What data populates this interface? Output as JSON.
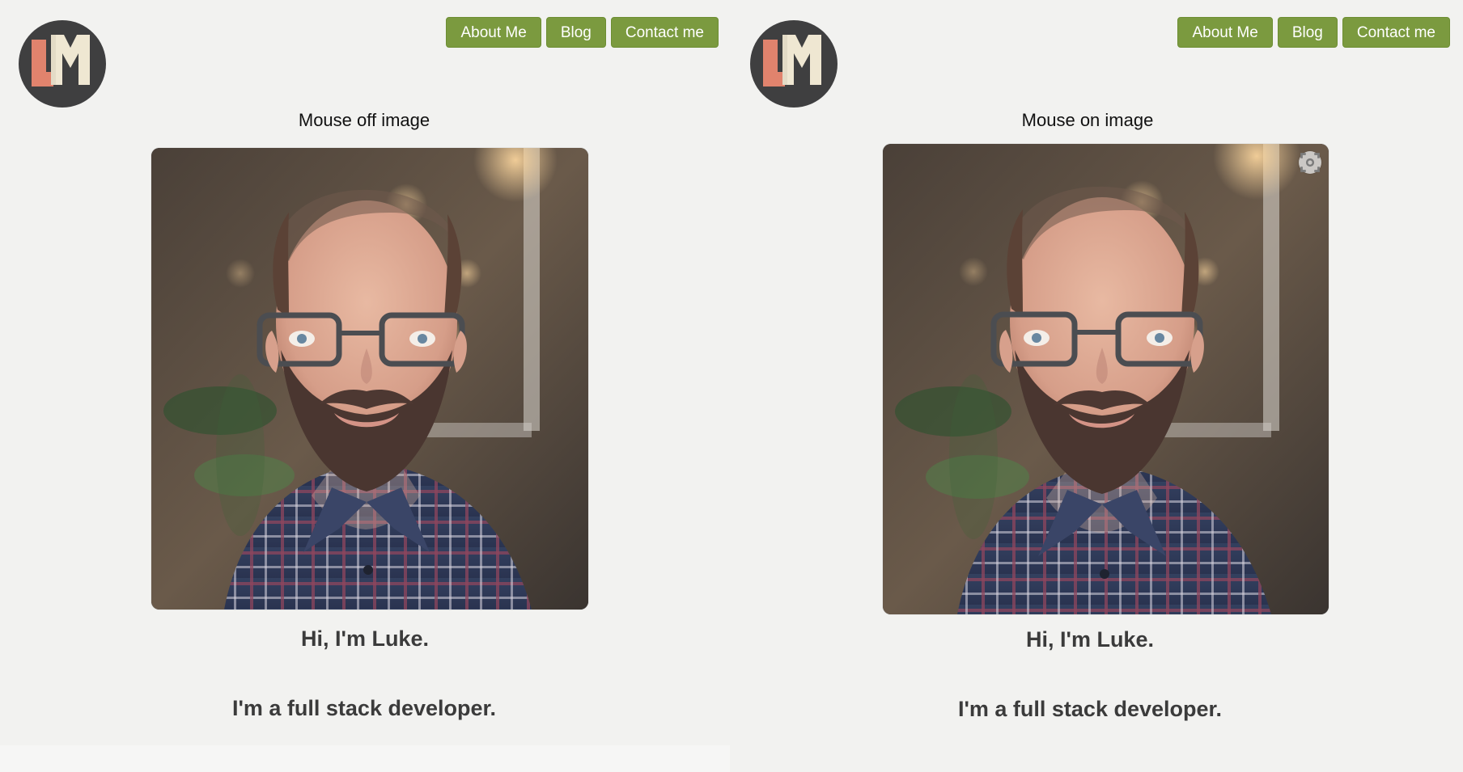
{
  "left": {
    "nav": {
      "about_label": "About Me",
      "blog_label": "Blog",
      "contact_label": "Contact me"
    },
    "caption": "Mouse off image",
    "intro": "Hi, I'm Luke.",
    "role": "I'm a full stack developer."
  },
  "right": {
    "nav": {
      "about_label": "About Me",
      "blog_label": "Blog",
      "contact_label": "Contact me"
    },
    "caption": "Mouse on image",
    "intro": "Hi, I'm Luke.",
    "role": "I'm a full stack developer."
  },
  "colors": {
    "background": "#f2f2f0",
    "accent": "#7b9a3f",
    "logo_dark": "#3f3f40",
    "logo_orange": "#e1836d",
    "logo_cream": "#efe7d2"
  },
  "icons": {
    "logo": "lm-logo",
    "hover_control": "scan-icon"
  }
}
